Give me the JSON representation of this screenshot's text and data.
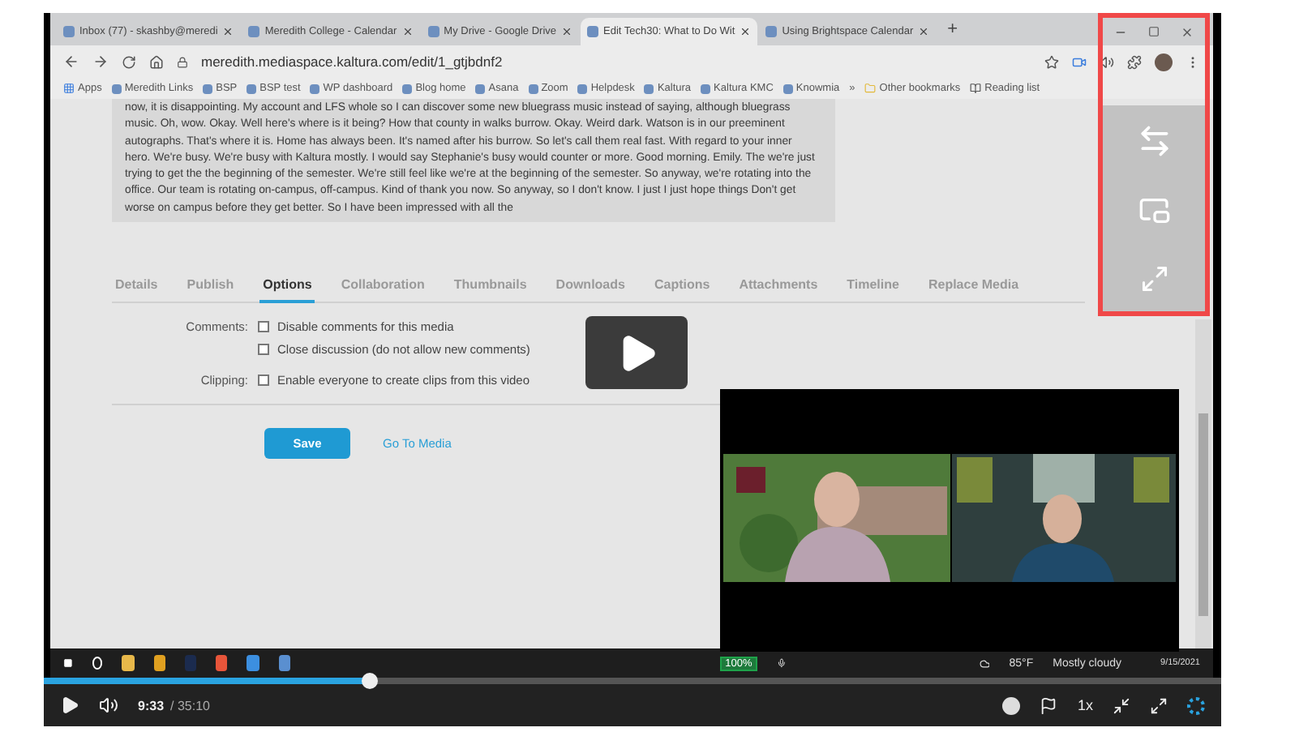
{
  "browser": {
    "tabs": [
      {
        "title": "Inbox (77) - skashby@meredi",
        "selected": false
      },
      {
        "title": "Meredith College - Calendar",
        "selected": false
      },
      {
        "title": "My Drive - Google Drive",
        "selected": false
      },
      {
        "title": "Edit Tech30: What to Do Wit",
        "selected": true
      },
      {
        "title": "Using Brightspace Calendar",
        "selected": false
      }
    ],
    "new_tab": "+",
    "url": "meredith.mediaspace.kaltura.com/edit/1_gtjbdnf2",
    "bookmarks": [
      "Apps",
      "Meredith Links",
      "BSP",
      "BSP test",
      "WP dashboard",
      "Blog home",
      "Asana",
      "Zoom",
      "Helpdesk",
      "Kaltura",
      "Kaltura KMC",
      "Knowmia"
    ],
    "more_bookmarks": "»",
    "other_bookmarks": "Other bookmarks",
    "reading_list": "Reading list"
  },
  "transcript": "now, it is disappointing. My account and LFS whole so I can discover some new bluegrass music instead of saying, although bluegrass music. Oh, wow. Okay. Well here's where is it being? How that county in walks burrow. Okay. Weird dark. Watson is in our preeminent autographs. That's where it is. Home has always been. It's named after his burrow. So let's call them real fast. With regard to your inner hero. We're busy. We're busy with Kaltura mostly. I would say Stephanie's busy would counter or more. Good morning. Emily. The we're just trying to get the the beginning of the semester. We're still feel like we're at the beginning of the semester. So anyway, we're rotating into the office. Our team is rotating on-campus, off-campus. Kind of thank you now. So anyway, so I don't know. I just I just hope things Don't get worse on campus before they get better. So I have been impressed with all the",
  "media_tabs": [
    {
      "label": "Details",
      "selected": false
    },
    {
      "label": "Publish",
      "selected": false
    },
    {
      "label": "Options",
      "selected": true
    },
    {
      "label": "Collaboration",
      "selected": false
    },
    {
      "label": "Thumbnails",
      "selected": false
    },
    {
      "label": "Downloads",
      "selected": false
    },
    {
      "label": "Captions",
      "selected": false
    },
    {
      "label": "Attachments",
      "selected": false
    },
    {
      "label": "Timeline",
      "selected": false
    },
    {
      "label": "Replace Media",
      "selected": false
    }
  ],
  "options": [
    {
      "label": "Comments:",
      "checkboxes": [
        {
          "text": "Disable comments for this media",
          "checked": false
        },
        {
          "text": "Close discussion (do not allow new comments)",
          "checked": false
        }
      ]
    },
    {
      "label": "Clipping:",
      "checkboxes": [
        {
          "text": "Enable everyone to create clips from this video",
          "checked": false
        }
      ]
    }
  ],
  "save_button": "Save",
  "go_to_media": "Go To Media",
  "taskbar": {
    "battery": "100%",
    "temperature": "85°F",
    "weather": "Mostly cloudy",
    "date": "9/15/2021"
  },
  "player": {
    "level": 0.277,
    "time": "9:33",
    "duration": "/ 35:10",
    "speed": "1x"
  }
}
